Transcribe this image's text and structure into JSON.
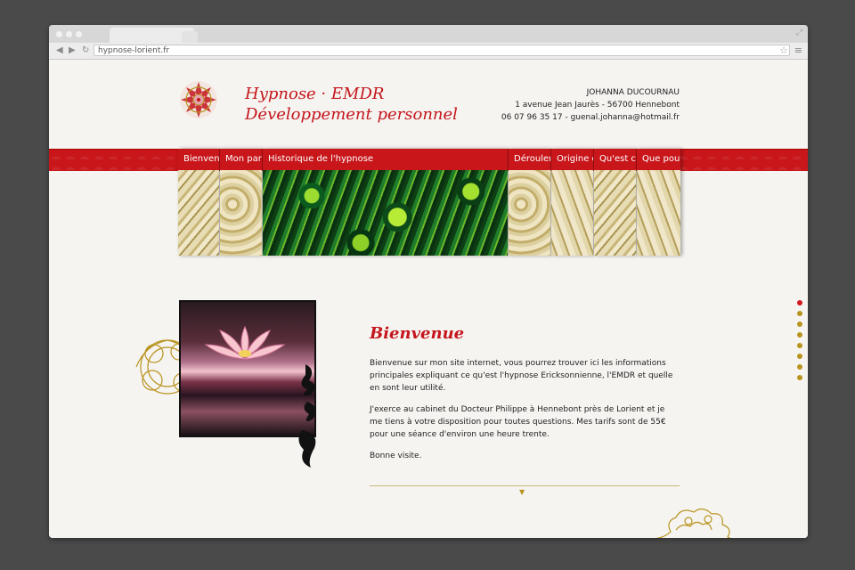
{
  "browser": {
    "url": "hypnose-lorient.fr"
  },
  "header": {
    "title_line1": "Hypnose · EMDR",
    "title_line2": "Développement personnel",
    "contact": {
      "name": "JOHANNA DUCOURNAU",
      "address": "1 avenue Jean Jaurès - 56700 Hennebont",
      "phone_email": "06 07 96 35 17 - guenal.johanna@hotmail.fr"
    }
  },
  "nav": {
    "items": [
      {
        "label": "Bienvenue",
        "style": "gold"
      },
      {
        "label": "Mon parc",
        "style": "gold2"
      },
      {
        "label": "Historique de l'hypnose",
        "style": "peacock"
      },
      {
        "label": "Déroulem",
        "style": "gold2"
      },
      {
        "label": "Origine de",
        "style": "gold3"
      },
      {
        "label": "Qu'est ce",
        "style": "gold"
      },
      {
        "label": "Que pouv",
        "style": "gold3"
      }
    ]
  },
  "main": {
    "heading": "Bienvenue",
    "paragraphs": [
      "Bienvenue sur mon site internet, vous pourrez trouver ici les informations principales expliquant ce qu'est l'hypnose Ericksonnienne, l'EMDR et quelle en sont leur utilité.",
      "J'exerce au cabinet du Docteur Philippe à Hennebont près de Lorient et je me tiens à votre disposition pour toutes questions. Mes tarifs sont de 55€ pour une séance d'environ une heure trente.",
      "Bonne visite."
    ]
  },
  "side_dots": {
    "count": 8,
    "active_index": 0
  },
  "colors": {
    "accent_red": "#c4161c",
    "gold": "#b8941f",
    "background": "#f6f4f1"
  },
  "icons": {
    "back": "arrow-left-icon",
    "forward": "arrow-right-icon",
    "reload": "reload-icon",
    "bookmark": "star-icon",
    "menu": "hamburger-icon",
    "scroll": "triangle-down-icon"
  }
}
